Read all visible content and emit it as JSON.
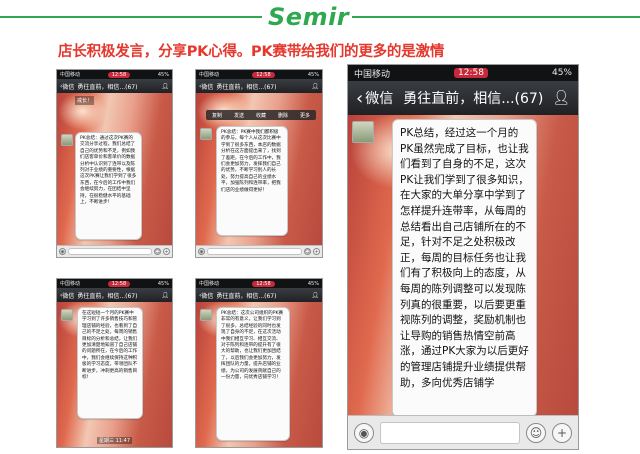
{
  "brand": {
    "logo_text": "Semir",
    "accent": "#2fa84f"
  },
  "headline": {
    "text": "店长积极发言，分享PK心得。PK赛带给我们的更多的是激情",
    "color": "#e4382e"
  },
  "phones": [
    {
      "status": {
        "carrier": "中国移动",
        "time": "12:58",
        "battery": "45%"
      },
      "nav": {
        "back_label": "微信",
        "title": "勇往直前，相信...(67)"
      },
      "top_tag": "戒长！",
      "message": "PK总结：通过这次PK赛的交流分享过程，我们总结了自己的优势和不足，例如我们店客单价和客单价的数据分析中认识到了连带以及陈列对于业绩的重要性，根据这次PK赛让我们学到了很多东西，在今后的工作中我们会继续努力，在团结中坚持，在很稳健水平的基础上，不断进步！",
      "bottom_label": ""
    },
    {
      "status": {
        "carrier": "中国移动",
        "time": "12:58",
        "battery": "45%"
      },
      "nav": {
        "back_label": "微信",
        "title": "勇往直前，相信...(67)"
      },
      "menu_items": [
        "复制",
        "发送",
        "收藏",
        "删除",
        "更多"
      ],
      "message": "PK总结：PK赛中我们都积极的参与，每个人从这次比赛中学到了很多东西，本店的数据分析在这方面提出来了，找到了差距，在今后的工作中，我们会更加努力，发挥我们自己的优势，不断学习别人的长处，努力提高自己的业绩水平，加强陈列和连带率，把我们店的业绩做得更好！",
      "bottom_label": ""
    },
    {
      "status": {
        "carrier": "中国移动",
        "time": "12:58",
        "battery": "45%"
      },
      "nav": {
        "back_label": "微信",
        "title": "勇往直前，相信...(67)"
      },
      "message": "PK总结，经过这一个月的PK虽然完成了目标，也让我们看到了自身的不足，这次PK让我们学到了很多知识，在大家的大单分享中学到了怎样提升连带率，从每周的总结看出自己店铺所在的不足，针对不足之处积极改正，每周的目标任务也让我们有了积极向上的态度，从每周的陈列调整可以发现陈列真的很重要，以后要更重视陈列的调整，奖励机制也让导购的销售热情空前高涨，通过PK大家为以后更好的管理店铺提升业绩提供帮助，多向优秀店铺学",
      "bottom_label": ""
    },
    {
      "status": {
        "carrier": "中国移动",
        "time": "12:58",
        "battery": "45%"
      },
      "nav": {
        "back_label": "微信",
        "title": "勇往直前，相信...(67)"
      },
      "message": "在这短短一个月的PK赛中学习到了许多销售技巧和管理店铺的经验，也看到了自己的不足之处，每周的销售目标的分析和总结，让我们更加清楚地知道了自己店铺的问题所在，在今后的工作中，我们会继续保持这种积极的学习态度，带领团队不断进步，冲刺更高的销售目标！",
      "bottom_label": "星期三 11:47"
    },
    {
      "status": {
        "carrier": "中国移动",
        "time": "12:58",
        "battery": "45%"
      },
      "nav": {
        "back_label": "微信",
        "title": "勇往直前，相信...(67)"
      },
      "message": "PK总结：这次公司组织的PK赛非常的有意义，让我们学习到了很多，总结经验的同时也发现了自身的不足，在这次活动中我们相互学习、相互交流、对于陈列和连带的提升有了很大的帮助，也让我们更加团结了，以后我们会更加努力，发挥团队的力量，提升店铺的业绩，为公司的发展贡献自己的一份力量，向优秀店铺学习！",
      "bottom_label": ""
    }
  ],
  "icons": {
    "back": "chevron-left-icon",
    "people": "people-icon",
    "voice": "voice-icon",
    "emoji": "emoji-icon",
    "plus": "plus-icon"
  }
}
